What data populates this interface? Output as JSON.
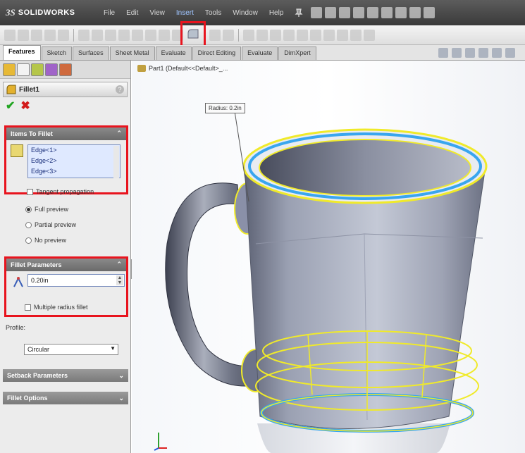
{
  "titlebar": {
    "brand_prefix": "3S",
    "brand_name": "SOLIDWORKS",
    "menus": [
      "File",
      "Edit",
      "View",
      "Insert",
      "Tools",
      "Window",
      "Help"
    ],
    "active_menu": "Insert"
  },
  "tabs": [
    "Features",
    "Sketch",
    "Surfaces",
    "Sheet Metal",
    "Evaluate",
    "Direct Editing",
    "Evaluate",
    "DimXpert"
  ],
  "active_tab": "Features",
  "feature_panel": {
    "title": "Fillet1",
    "ok_symbol": "✔",
    "cancel_symbol": "✖",
    "items_group": {
      "header": "Items To Fillet",
      "edges": [
        "Edge<1>",
        "Edge<2>",
        "Edge<3>"
      ],
      "tangent_propagation": "Tangent propagation"
    },
    "preview": {
      "options": [
        "Full preview",
        "Partial preview",
        "No preview"
      ],
      "selected": "Full preview"
    },
    "params_group": {
      "header": "Fillet Parameters",
      "radius_value": "0.20in",
      "multiple_radius": "Multiple radius fillet"
    },
    "profile_label": "Profile:",
    "profile_value": "Circular",
    "setback_group": "Setback Parameters",
    "options_group": "Fillet Options"
  },
  "viewport": {
    "crumb": "Part1 (Default<<Default>_...",
    "callout": "Radius: 0.2in"
  },
  "colors": {
    "highlight_red": "#e8141e",
    "selection_yellow": "#f0ea2a",
    "edge_blue": "#39a6ef"
  }
}
